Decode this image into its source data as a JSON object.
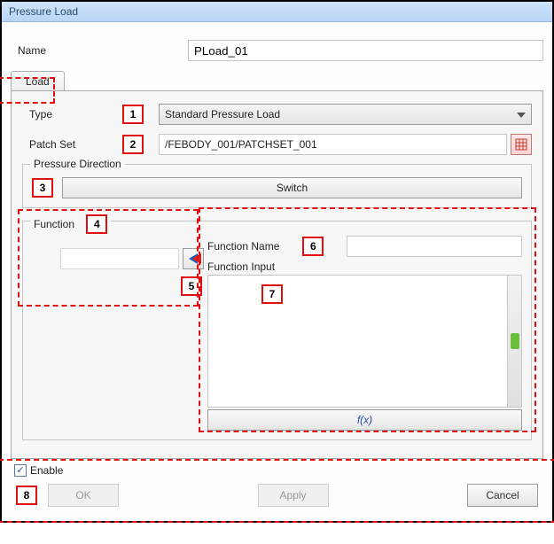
{
  "window": {
    "title": "Pressure Load"
  },
  "name": {
    "label": "Name",
    "value": "PLoad_01"
  },
  "tab": {
    "load": "Load"
  },
  "type": {
    "label": "Type",
    "value": "Standard Pressure Load"
  },
  "patch_set": {
    "label": "Patch Set",
    "value": "/FEBODY_001/PATCHSET_001"
  },
  "pressure_direction": {
    "title": "Pressure Direction",
    "switch": "Switch"
  },
  "function_group": {
    "title": "Function",
    "fn_name_label": "Function Name",
    "fn_name_value": "",
    "fn_input_label": "Function Input",
    "fn_input_text": "",
    "fx_label": "f(x)"
  },
  "enable": {
    "label": "Enable",
    "checked": true
  },
  "buttons": {
    "ok": "OK",
    "apply": "Apply",
    "cancel": "Cancel"
  },
  "annotations": {
    "n1": "1",
    "n2": "2",
    "n3": "3",
    "n4": "4",
    "n5": "5",
    "n6": "6",
    "n7": "7",
    "n8": "8"
  }
}
